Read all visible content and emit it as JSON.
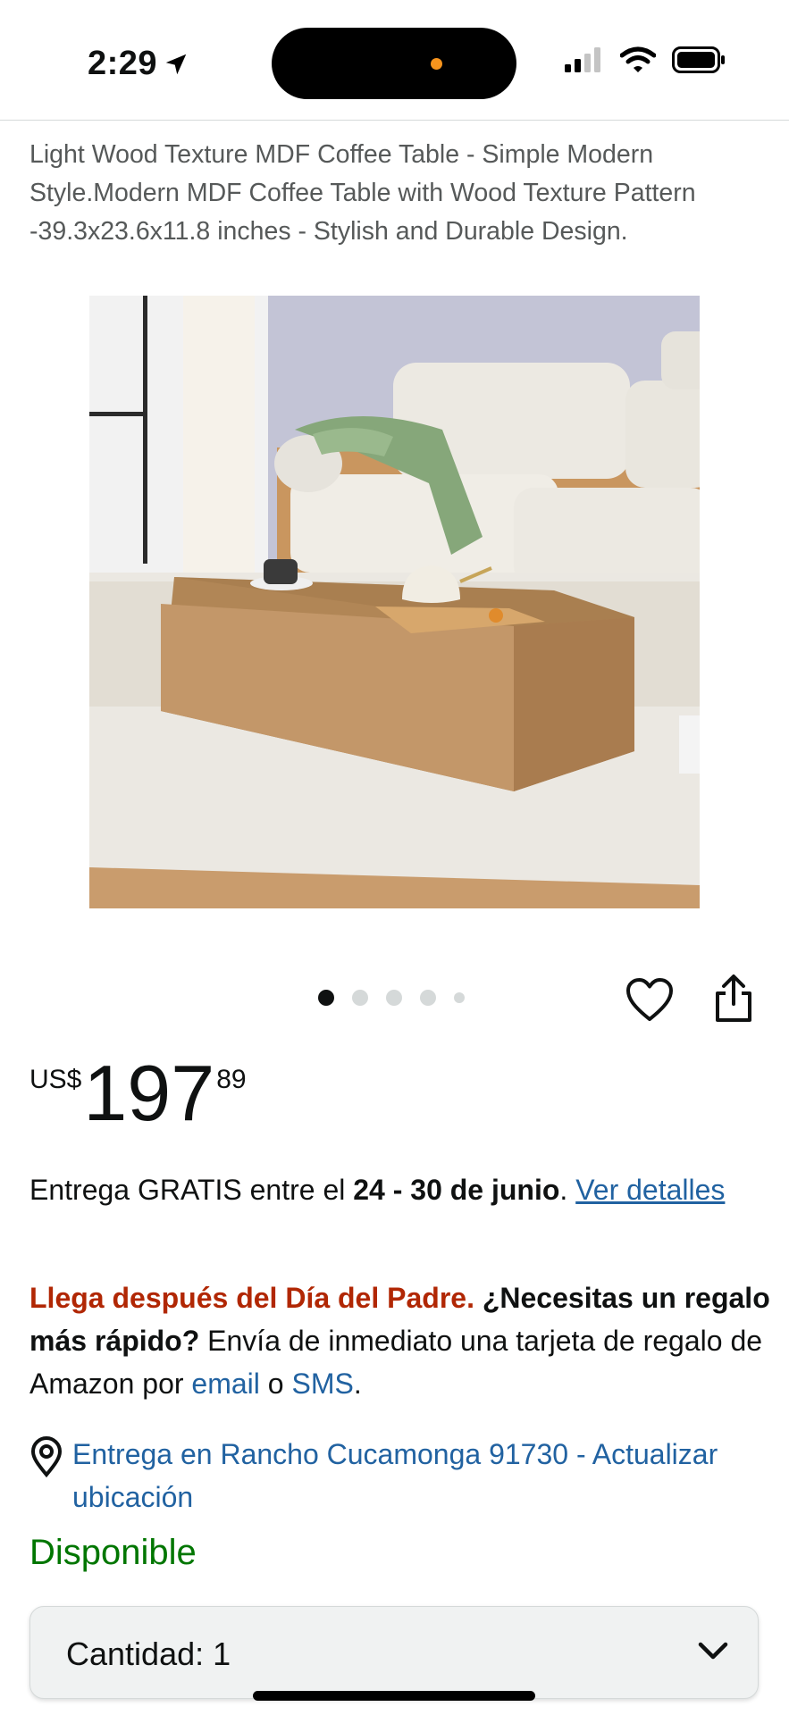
{
  "status_bar": {
    "time": "2:29"
  },
  "product": {
    "title": "Light Wood Texture MDF Coffee Table - Simple Modern Style.Modern MDF Coffee Table with Wood Texture Pattern -39.3x23.6x11.8 inches - Stylish and Durable Design.",
    "image_count": 5,
    "active_image_index": 0
  },
  "price": {
    "currency": "US$",
    "whole": "197",
    "fraction": "89"
  },
  "delivery": {
    "prefix": "Entrega GRATIS entre el ",
    "dates": "24 - 30 de junio",
    "suffix": ". ",
    "link": "Ver detalles"
  },
  "fathers_day": {
    "warning": "Llega después del Día del Padre.",
    "question": " ¿Necesitas un regalo más rápido?",
    "text_1": " Envía de inmediato una tarjeta de regalo de Amazon por ",
    "email": "email",
    "text_2": " o ",
    "sms": "SMS",
    "text_3": "."
  },
  "location": {
    "text": "Entrega en Rancho Cucamonga 91730 - Actualizar ubicación"
  },
  "availability": "Disponible",
  "quantity": {
    "label": "Cantidad:",
    "value": "1"
  },
  "icons": {
    "location_arrow": "location-arrow-icon",
    "signal": "signal-icon",
    "wifi": "wifi-icon",
    "battery": "battery-icon",
    "heart": "heart-icon",
    "share": "share-icon",
    "location_pin": "location-pin-icon",
    "chevron": "chevron-down-icon"
  },
  "colors": {
    "link_blue": "#2162a1",
    "deal_red": "#b12704",
    "in_stock_green": "#007600",
    "notch_dot": "#f7941d"
  }
}
